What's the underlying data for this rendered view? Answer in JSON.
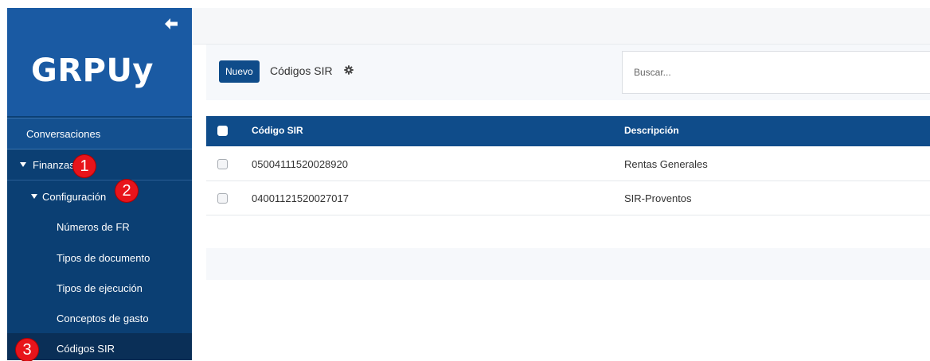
{
  "sidebar": {
    "logo": "GRPUy",
    "conversaciones": "Conversaciones",
    "finanzas": "Finanzas",
    "configuracion": "Configuración",
    "sub_items": [
      "Números de FR",
      "Tipos de documento",
      "Tipos de ejecución",
      "Conceptos de gasto",
      "Códigos SIR"
    ],
    "active_item": "Códigos SIR"
  },
  "badges": [
    "1",
    "2",
    "3"
  ],
  "header": {
    "new_button": "Nuevo",
    "title": "Códigos SIR",
    "search_placeholder": "Buscar..."
  },
  "table": {
    "columns": [
      "Código SIR",
      "Descripción"
    ],
    "rows": [
      {
        "code": "05004111520028920",
        "description": "Rentas Generales"
      },
      {
        "code": "04001121520027017",
        "description": "SIR-Proventos"
      }
    ]
  },
  "colors": {
    "sidebar_bg": "#0b3f73",
    "brand_bg": "#1a5aa3",
    "primary": "#0f4c8a",
    "badge": "#e8141b"
  },
  "icons": [
    "back-arrow-icon",
    "gear-icon",
    "caret-down-icon",
    "checkbox-icon"
  ]
}
